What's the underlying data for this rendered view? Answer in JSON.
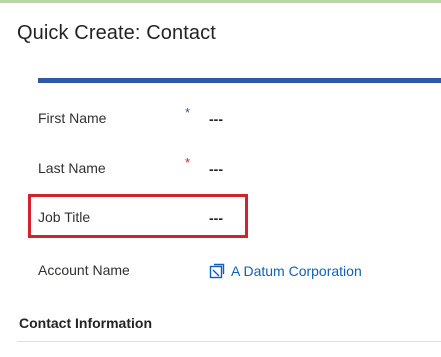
{
  "form": {
    "title": "Quick Create: Contact"
  },
  "fields": {
    "first_name": {
      "label": "First Name",
      "required_marker": "*",
      "value": "---"
    },
    "last_name": {
      "label": "Last Name",
      "required_marker": "*",
      "value": "---"
    },
    "job_title": {
      "label": "Job Title",
      "value": "---"
    },
    "account_name": {
      "label": "Account Name",
      "value": "A Datum Corporation"
    }
  },
  "sections": {
    "contact_information": "Contact Information"
  },
  "icons": {
    "account_link": "entity-link-icon"
  },
  "colors": {
    "header_bar": "#2b59a6",
    "highlight": "#d0232d",
    "link": "#1160b7",
    "required_recommended": "#2b59a6",
    "required": "#c62828"
  }
}
